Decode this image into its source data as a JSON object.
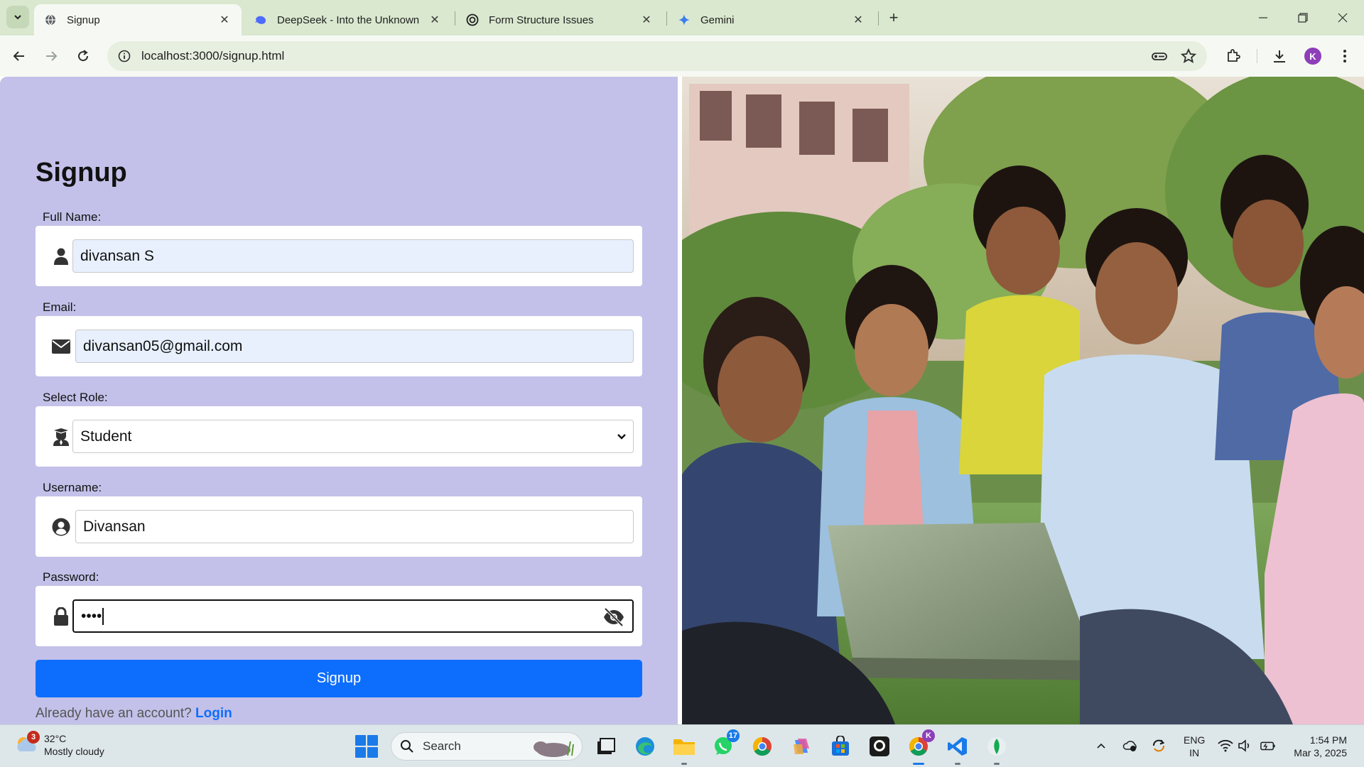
{
  "browser": {
    "tabs": [
      {
        "title": "Signup",
        "active": true
      },
      {
        "title": "DeepSeek - Into the Unknown",
        "active": false
      },
      {
        "title": "Form Structure Issues",
        "active": false
      },
      {
        "title": "Gemini",
        "active": false
      }
    ],
    "url": "localhost:3000/signup.html",
    "profile_initial": "K"
  },
  "form": {
    "title": "Signup",
    "fields": {
      "full_name": {
        "label": "Full Name:",
        "value": "divansan S",
        "icon": "user-icon"
      },
      "email": {
        "label": "Email:",
        "value": "divansan05@gmail.com",
        "icon": "envelope-icon"
      },
      "role": {
        "label": "Select Role:",
        "value": "Student",
        "icon": "graduate-icon"
      },
      "username": {
        "label": "Username:",
        "value": "Divansan",
        "icon": "user-circle-icon"
      },
      "password": {
        "label": "Password:",
        "value": "••••",
        "icon": "lock-icon"
      }
    },
    "submit_label": "Signup",
    "login_prompt": "Already have an account?",
    "login_link": "Login",
    "accent_color": "#0d6efd",
    "panel_color": "#c3c1e9"
  },
  "hero_image": {
    "icon": "students-photo"
  },
  "taskbar": {
    "weather": {
      "temp": "32°C",
      "condition": "Mostly cloudy",
      "badge": "3"
    },
    "search_label": "Search",
    "whatsapp_badge": "17",
    "chrome_badge": "K",
    "lang_line1": "ENG",
    "lang_line2": "IN",
    "time": "1:54 PM",
    "date": "Mar 3, 2025"
  }
}
